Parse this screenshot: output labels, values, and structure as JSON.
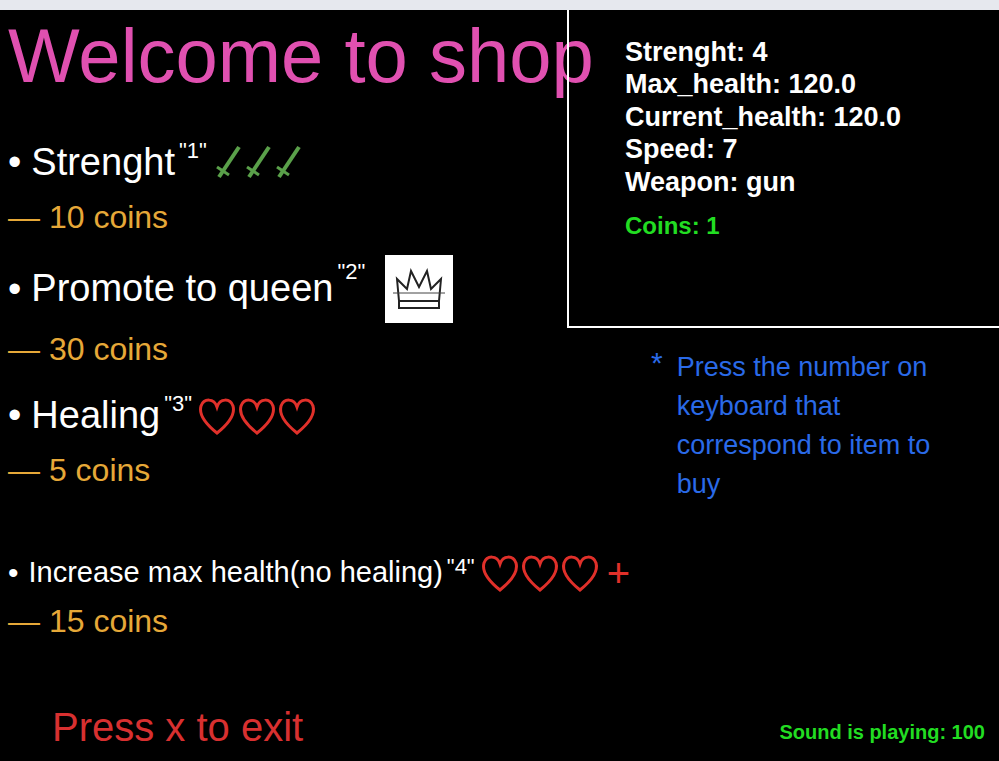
{
  "title": "Welcome to shop",
  "items": [
    {
      "bullet": "•",
      "label": "Strenght",
      "key": "\"1\"",
      "cost": "— 10 coins",
      "kind": "strength",
      "suffix": ""
    },
    {
      "bullet": "•",
      "label": "Promote to queen",
      "key": "\"2\"",
      "cost": "— 30 coins",
      "kind": "queen",
      "suffix": ""
    },
    {
      "bullet": "•",
      "label": "Healing",
      "key": "\"3\"",
      "cost": "— 5 coins",
      "kind": "healing",
      "suffix": ""
    },
    {
      "bullet": "•",
      "label": "Increase max health(no healing)",
      "key": "\"4\"",
      "cost": "— 15 coins",
      "kind": "maxhealth",
      "suffix": "+"
    }
  ],
  "stats": [
    "Strenght: 4",
    "Max_health: 120.0",
    "Current_health: 120.0",
    "Speed: 7",
    "Weapon: gun"
  ],
  "coins": "Coins: 1",
  "hint": {
    "marker": "*",
    "text": "Press the number on keyboard that correspond to item to buy"
  },
  "exit": "Press x to exit",
  "sound": "Sound is playing: 100"
}
